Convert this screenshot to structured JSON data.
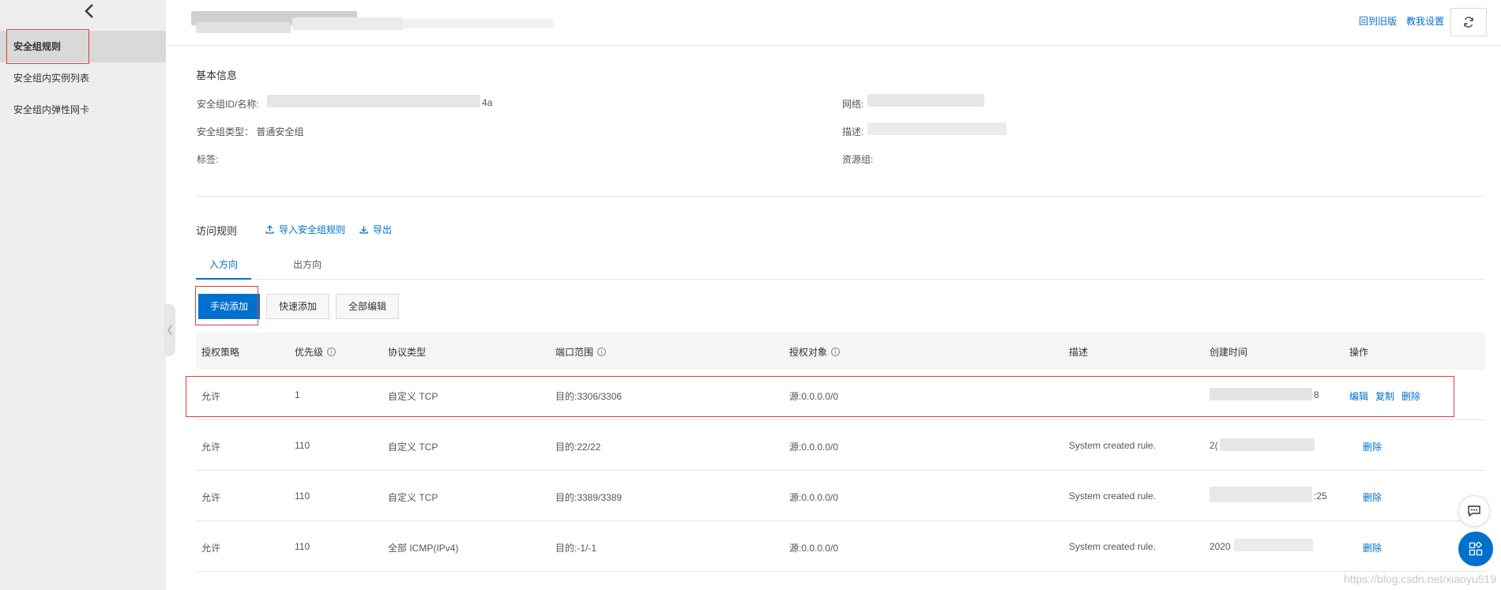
{
  "sidebar": {
    "back_icon": "chevron-left-icon",
    "items": [
      {
        "label": "安全组规则",
        "active": true
      },
      {
        "label": "安全组内实例列表",
        "active": false
      },
      {
        "label": "安全组内弹性网卡",
        "active": false
      }
    ],
    "collapse_icon": "chevron-left-icon"
  },
  "header": {
    "links": [
      "回到旧版",
      "教我设置"
    ],
    "refresh_icon": "refresh-icon"
  },
  "basic_info": {
    "title": "基本信息",
    "id_name_label": "安全组ID/名称:",
    "id_tail": "4a",
    "type_label": "安全组类型：",
    "type_value": "普通安全组",
    "tag_label": "标签:",
    "network_label": "网络:",
    "desc_label": "描述:",
    "resource_group_label": "资源组:"
  },
  "rules": {
    "title": "访问规则",
    "import_label": "导入安全组规则",
    "export_label": "导出",
    "tabs": [
      "入方向",
      "出方向"
    ],
    "buttons": {
      "manual_add": "手动添加",
      "quick_add": "快速添加",
      "edit_all": "全部编辑"
    },
    "columns": [
      "授权策略",
      "优先级",
      "协议类型",
      "端口范围",
      "授权对象",
      "描述",
      "创建时间",
      "操作"
    ],
    "rows": [
      {
        "policy": "允许",
        "priority": "1",
        "protocol": "自定义 TCP",
        "port": "目的:3306/3306",
        "source": "源:0.0.0.0/0",
        "desc": "",
        "time_tail": "8",
        "ops": [
          "编辑",
          "复制",
          "删除"
        ]
      },
      {
        "policy": "允许",
        "priority": "110",
        "protocol": "自定义 TCP",
        "port": "目的:22/22",
        "source": "源:0.0.0.0/0",
        "desc": "System created rule.",
        "time_tail": "2(",
        "ops": [
          "删除"
        ]
      },
      {
        "policy": "允许",
        "priority": "110",
        "protocol": "自定义 TCP",
        "port": "目的:3389/3389",
        "source": "源:0.0.0.0/0",
        "desc": "System created rule.",
        "time_tail": ":25",
        "ops": [
          "删除"
        ]
      },
      {
        "policy": "允许",
        "priority": "110",
        "protocol": "全部 ICMP(IPv4)",
        "port": "目的:-1/-1",
        "source": "源:0.0.0.0/0",
        "desc": "System created rule.",
        "time_tail": "2020",
        "ops": [
          "删除"
        ]
      }
    ]
  },
  "floating": {
    "chat_icon": "chat-icon",
    "apps_icon": "apps-grid-icon"
  },
  "watermark": "https://blog.csdn.net/xiaoyu519"
}
